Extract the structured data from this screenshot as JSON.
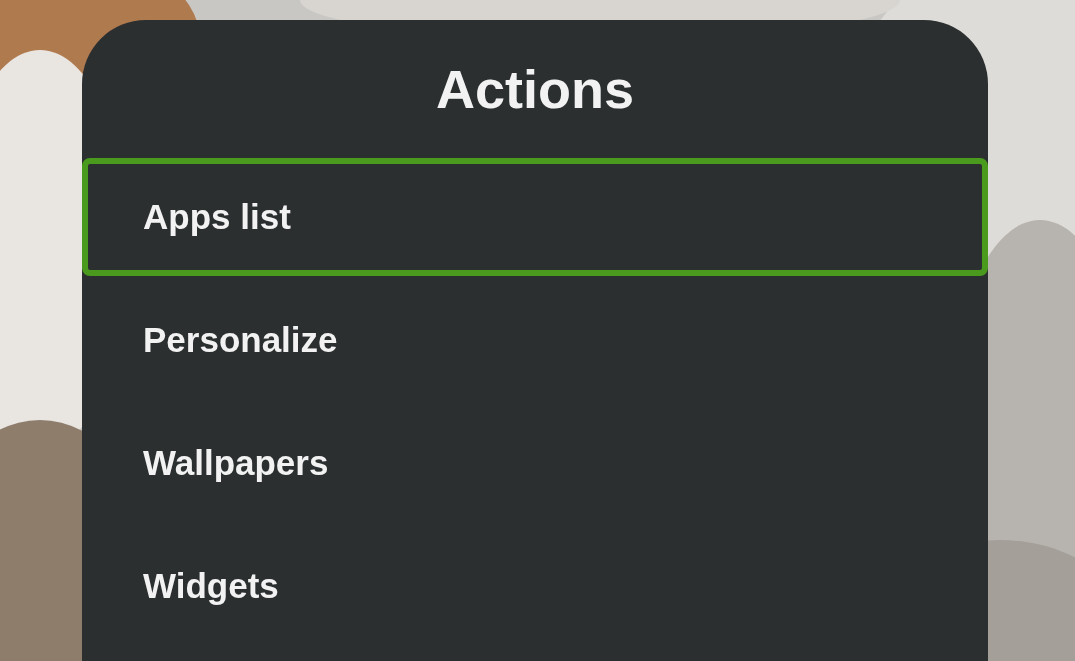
{
  "dialog": {
    "title": "Actions",
    "items": [
      {
        "label": "Apps list",
        "selected": true
      },
      {
        "label": "Personalize",
        "selected": false
      },
      {
        "label": "Wallpapers",
        "selected": false
      },
      {
        "label": "Widgets",
        "selected": false
      }
    ]
  }
}
